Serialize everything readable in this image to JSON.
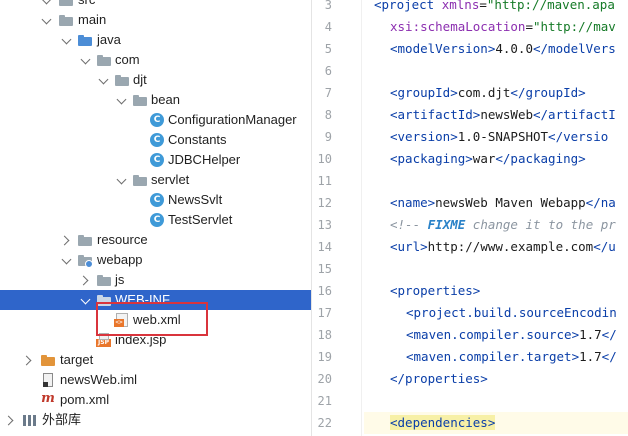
{
  "tree": {
    "items": [
      {
        "label": "src",
        "icon": "folder-icon"
      },
      {
        "label": "main",
        "icon": "folder-icon"
      },
      {
        "label": "java",
        "icon": "source-folder-icon"
      },
      {
        "label": "com",
        "icon": "package-icon"
      },
      {
        "label": "djt",
        "icon": "package-icon"
      },
      {
        "label": "bean",
        "icon": "package-icon"
      },
      {
        "label": "ConfigurationManager",
        "icon": "class-icon"
      },
      {
        "label": "Constants",
        "icon": "class-icon"
      },
      {
        "label": "JDBCHelper",
        "icon": "class-icon"
      },
      {
        "label": "servlet",
        "icon": "package-icon"
      },
      {
        "label": "NewsSvlt",
        "icon": "class-icon"
      },
      {
        "label": "TestServlet",
        "icon": "class-icon"
      },
      {
        "label": "resource",
        "icon": "folder-icon"
      },
      {
        "label": "webapp",
        "icon": "web-folder-icon"
      },
      {
        "label": "js",
        "icon": "folder-icon"
      },
      {
        "label": "WEB-INF",
        "icon": "folder-icon"
      },
      {
        "label": "web.xml",
        "icon": "xml-file-icon"
      },
      {
        "label": "index.jsp",
        "icon": "jsp-file-icon"
      },
      {
        "label": "target",
        "icon": "excluded-folder-icon"
      },
      {
        "label": "newsWeb.iml",
        "icon": "iml-file-icon"
      },
      {
        "label": "pom.xml",
        "icon": "maven-file-icon"
      },
      {
        "label": "外部库",
        "icon": "library-icon"
      }
    ],
    "selected": "WEB-INF",
    "highlight_color": "#d9343c",
    "selection_color": "#2f65ca"
  },
  "editor": {
    "line_numbers": [
      "3",
      "4",
      "5",
      "6",
      "7",
      "8",
      "9",
      "10",
      "11",
      "12",
      "13",
      "14",
      "15",
      "16",
      "17",
      "18",
      "19",
      "20",
      "21",
      "22"
    ],
    "lines": {
      "l3": {
        "open": "<project ",
        "attr": "xmlns",
        "eq": "=",
        "val": "\"http://maven.apa"
      },
      "l4": {
        "attr": "xsi:schemaLocation",
        "eq": "=",
        "val": "\"http://mav"
      },
      "l5": {
        "tag_open": "<modelVersion>",
        "text": "4.0.0",
        "tag_close": "</modelVers"
      },
      "l7": {
        "tag_open": "<groupId>",
        "text": "com.djt",
        "tag_close": "</groupId>"
      },
      "l8": {
        "tag_open": "<artifactId>",
        "text": "newsWeb",
        "tag_close": "</artifactI"
      },
      "l9": {
        "tag_open": "<version>",
        "text": "1.0-SNAPSHOT",
        "tag_close": "</versio"
      },
      "l10": {
        "tag_open": "<packaging>",
        "text": "war",
        "tag_close": "</packaging>"
      },
      "l12": {
        "tag_open": "<name>",
        "text": "newsWeb Maven Webapp",
        "tag_close": "</na"
      },
      "l13": {
        "c_open": "<!-- ",
        "c_key": "FIXME",
        "c_text": " change it to the pr"
      },
      "l14": {
        "tag_open": "<url>",
        "text": "http://www.example.com",
        "tag_close": "</u"
      },
      "l16": {
        "tag_open": "<properties>"
      },
      "l17": {
        "tag_open": "<project.build.sourceEncodin"
      },
      "l18": {
        "tag_open": "<maven.compiler.source>",
        "text": "1.7",
        "tag_close": "</"
      },
      "l19": {
        "tag_open": "<maven.compiler.target>",
        "text": "1.7",
        "tag_close": "</"
      },
      "l20": {
        "tag_close": "</properties>"
      },
      "l22": {
        "tag_open": "<dependencies>"
      }
    }
  }
}
